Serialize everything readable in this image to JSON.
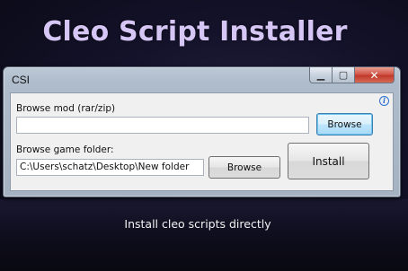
{
  "banner": {
    "title": "Cleo Script Installer",
    "tagline": "Install cleo scripts directly"
  },
  "window": {
    "title": "CSI",
    "controls": {
      "minimize_icon": "minimize-icon",
      "maximize_icon": "maximize-icon",
      "close_icon": "close-icon",
      "minimize_glyph": "▁",
      "maximize_glyph": "▢",
      "close_glyph": "✕"
    }
  },
  "form": {
    "mod_label": "Browse mod (rar/zip)",
    "mod_value": "",
    "mod_browse_label": "Browse",
    "folder_label": "Browse game folder:",
    "folder_value": "C:\\Users\\schatz\\Desktop\\New folder",
    "folder_browse_label": "Browse",
    "install_label": "Install",
    "info_glyph": "i"
  },
  "colors": {
    "title_text": "#d6c6f6",
    "close_button": "#c03a2b",
    "focus_border": "#3c7fb1",
    "info_icon": "#2b6fd1"
  }
}
